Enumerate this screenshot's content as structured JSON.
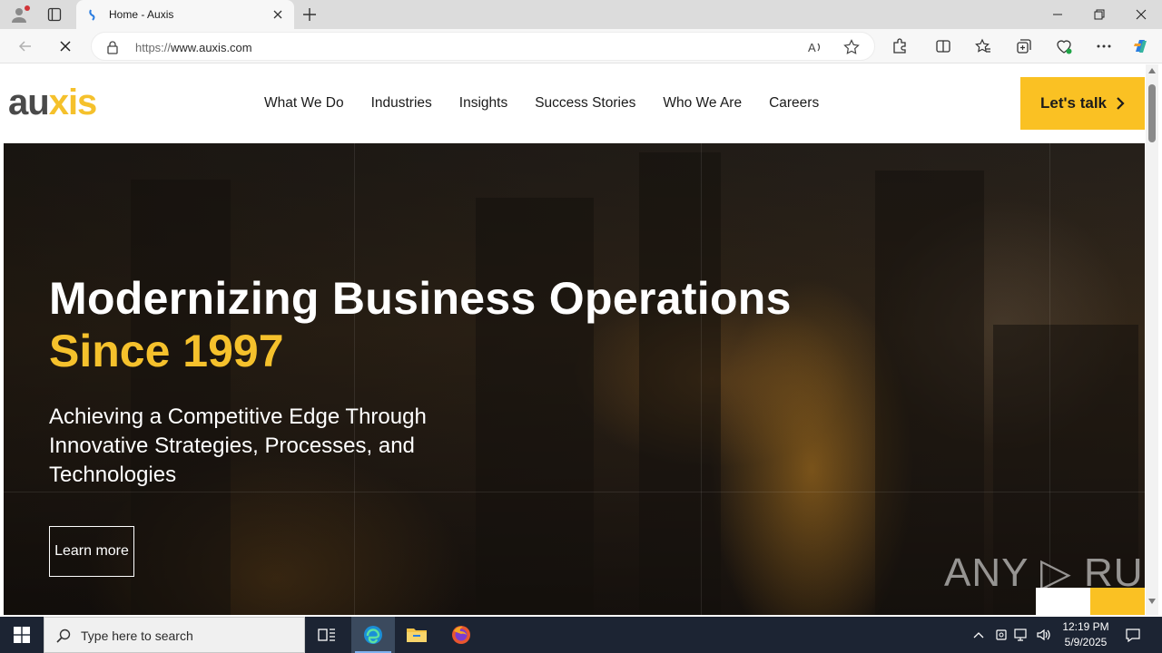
{
  "browser": {
    "tab": {
      "title": "Home - Auxis"
    },
    "address": {
      "url_prefix": "https://",
      "url_host": "www.auxis.com"
    }
  },
  "site": {
    "logo": {
      "part1": "au",
      "part2": "x",
      "part3": "is"
    },
    "nav": [
      "What We Do",
      "Industries",
      "Insights",
      "Success Stories",
      "Who We Are",
      "Careers"
    ],
    "cta_label": "Let's talk",
    "hero": {
      "title_line1": "Modernizing Business Operations",
      "title_line2": "Since 1997",
      "subtitle": "Achieving a Competitive Edge Through Innovative Strategies, Processes, and Technologies",
      "button_label": "Learn more"
    },
    "watermark": "ANY ▷ RUN"
  },
  "taskbar": {
    "search_placeholder": "Type here to search",
    "clock_time": "12:19 PM",
    "clock_date": "5/9/2025"
  },
  "colors": {
    "brand_yellow": "#fac123",
    "logo_gray": "#4a4a4a",
    "taskbar_bg": "#1c2433"
  }
}
